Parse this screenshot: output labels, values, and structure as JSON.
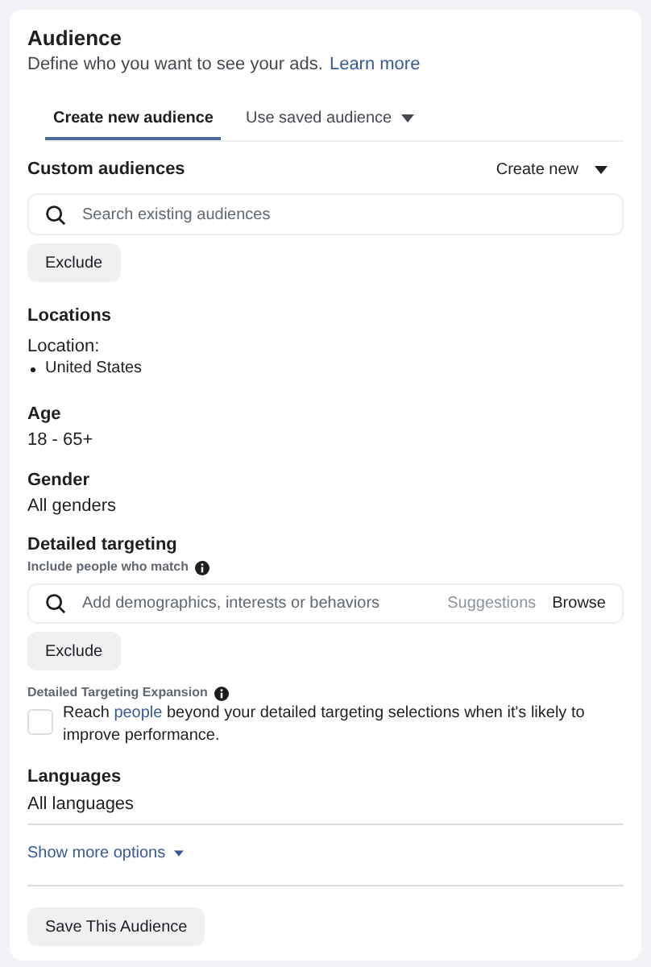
{
  "header": {
    "title": "Audience",
    "subtitle": "Define who you want to see your ads.",
    "learn_more": "Learn more"
  },
  "tabs": [
    {
      "label": "Create new audience",
      "selected": true,
      "dropdown": false
    },
    {
      "label": "Use saved audience",
      "selected": false,
      "dropdown": true
    }
  ],
  "custom_audiences": {
    "label": "Custom audiences",
    "create_new": "Create new",
    "search": {
      "placeholder": "Search existing audiences"
    },
    "exclude": "Exclude"
  },
  "locations": {
    "label": "Locations",
    "sublabel": "Location:",
    "items": [
      "United States"
    ]
  },
  "age": {
    "label": "Age",
    "value": "18 - 65+"
  },
  "gender": {
    "label": "Gender",
    "value": "All genders"
  },
  "detailed_targeting": {
    "label": "Detailed targeting",
    "sublabel": "Include people who match",
    "search": {
      "placeholder": "Add demographics, interests or behaviors"
    },
    "suggestions": "Suggestions",
    "browse": "Browse",
    "exclude": "Exclude"
  },
  "expansion": {
    "label": "Detailed Targeting Expansion",
    "checked": false,
    "text_before": "Reach",
    "link": "people",
    "text_after": "beyond your detailed targeting selections when it's likely to improve performance."
  },
  "languages": {
    "label": "Languages",
    "value": "All languages"
  },
  "show_more": "Show more options",
  "save_button": "Save This Audience"
}
